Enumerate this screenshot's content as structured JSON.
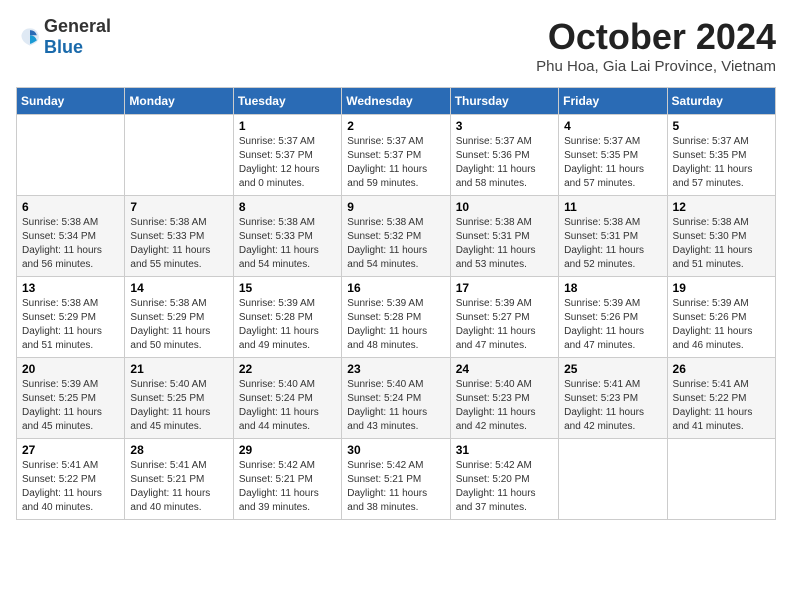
{
  "header": {
    "logo_general": "General",
    "logo_blue": "Blue",
    "month": "October 2024",
    "location": "Phu Hoa, Gia Lai Province, Vietnam"
  },
  "weekdays": [
    "Sunday",
    "Monday",
    "Tuesday",
    "Wednesday",
    "Thursday",
    "Friday",
    "Saturday"
  ],
  "weeks": [
    [
      {
        "day": "",
        "detail": ""
      },
      {
        "day": "",
        "detail": ""
      },
      {
        "day": "1",
        "detail": "Sunrise: 5:37 AM\nSunset: 5:37 PM\nDaylight: 12 hours\nand 0 minutes."
      },
      {
        "day": "2",
        "detail": "Sunrise: 5:37 AM\nSunset: 5:37 PM\nDaylight: 11 hours\nand 59 minutes."
      },
      {
        "day": "3",
        "detail": "Sunrise: 5:37 AM\nSunset: 5:36 PM\nDaylight: 11 hours\nand 58 minutes."
      },
      {
        "day": "4",
        "detail": "Sunrise: 5:37 AM\nSunset: 5:35 PM\nDaylight: 11 hours\nand 57 minutes."
      },
      {
        "day": "5",
        "detail": "Sunrise: 5:37 AM\nSunset: 5:35 PM\nDaylight: 11 hours\nand 57 minutes."
      }
    ],
    [
      {
        "day": "6",
        "detail": "Sunrise: 5:38 AM\nSunset: 5:34 PM\nDaylight: 11 hours\nand 56 minutes."
      },
      {
        "day": "7",
        "detail": "Sunrise: 5:38 AM\nSunset: 5:33 PM\nDaylight: 11 hours\nand 55 minutes."
      },
      {
        "day": "8",
        "detail": "Sunrise: 5:38 AM\nSunset: 5:33 PM\nDaylight: 11 hours\nand 54 minutes."
      },
      {
        "day": "9",
        "detail": "Sunrise: 5:38 AM\nSunset: 5:32 PM\nDaylight: 11 hours\nand 54 minutes."
      },
      {
        "day": "10",
        "detail": "Sunrise: 5:38 AM\nSunset: 5:31 PM\nDaylight: 11 hours\nand 53 minutes."
      },
      {
        "day": "11",
        "detail": "Sunrise: 5:38 AM\nSunset: 5:31 PM\nDaylight: 11 hours\nand 52 minutes."
      },
      {
        "day": "12",
        "detail": "Sunrise: 5:38 AM\nSunset: 5:30 PM\nDaylight: 11 hours\nand 51 minutes."
      }
    ],
    [
      {
        "day": "13",
        "detail": "Sunrise: 5:38 AM\nSunset: 5:29 PM\nDaylight: 11 hours\nand 51 minutes."
      },
      {
        "day": "14",
        "detail": "Sunrise: 5:38 AM\nSunset: 5:29 PM\nDaylight: 11 hours\nand 50 minutes."
      },
      {
        "day": "15",
        "detail": "Sunrise: 5:39 AM\nSunset: 5:28 PM\nDaylight: 11 hours\nand 49 minutes."
      },
      {
        "day": "16",
        "detail": "Sunrise: 5:39 AM\nSunset: 5:28 PM\nDaylight: 11 hours\nand 48 minutes."
      },
      {
        "day": "17",
        "detail": "Sunrise: 5:39 AM\nSunset: 5:27 PM\nDaylight: 11 hours\nand 47 minutes."
      },
      {
        "day": "18",
        "detail": "Sunrise: 5:39 AM\nSunset: 5:26 PM\nDaylight: 11 hours\nand 47 minutes."
      },
      {
        "day": "19",
        "detail": "Sunrise: 5:39 AM\nSunset: 5:26 PM\nDaylight: 11 hours\nand 46 minutes."
      }
    ],
    [
      {
        "day": "20",
        "detail": "Sunrise: 5:39 AM\nSunset: 5:25 PM\nDaylight: 11 hours\nand 45 minutes."
      },
      {
        "day": "21",
        "detail": "Sunrise: 5:40 AM\nSunset: 5:25 PM\nDaylight: 11 hours\nand 45 minutes."
      },
      {
        "day": "22",
        "detail": "Sunrise: 5:40 AM\nSunset: 5:24 PM\nDaylight: 11 hours\nand 44 minutes."
      },
      {
        "day": "23",
        "detail": "Sunrise: 5:40 AM\nSunset: 5:24 PM\nDaylight: 11 hours\nand 43 minutes."
      },
      {
        "day": "24",
        "detail": "Sunrise: 5:40 AM\nSunset: 5:23 PM\nDaylight: 11 hours\nand 42 minutes."
      },
      {
        "day": "25",
        "detail": "Sunrise: 5:41 AM\nSunset: 5:23 PM\nDaylight: 11 hours\nand 42 minutes."
      },
      {
        "day": "26",
        "detail": "Sunrise: 5:41 AM\nSunset: 5:22 PM\nDaylight: 11 hours\nand 41 minutes."
      }
    ],
    [
      {
        "day": "27",
        "detail": "Sunrise: 5:41 AM\nSunset: 5:22 PM\nDaylight: 11 hours\nand 40 minutes."
      },
      {
        "day": "28",
        "detail": "Sunrise: 5:41 AM\nSunset: 5:21 PM\nDaylight: 11 hours\nand 40 minutes."
      },
      {
        "day": "29",
        "detail": "Sunrise: 5:42 AM\nSunset: 5:21 PM\nDaylight: 11 hours\nand 39 minutes."
      },
      {
        "day": "30",
        "detail": "Sunrise: 5:42 AM\nSunset: 5:21 PM\nDaylight: 11 hours\nand 38 minutes."
      },
      {
        "day": "31",
        "detail": "Sunrise: 5:42 AM\nSunset: 5:20 PM\nDaylight: 11 hours\nand 37 minutes."
      },
      {
        "day": "",
        "detail": ""
      },
      {
        "day": "",
        "detail": ""
      }
    ]
  ]
}
